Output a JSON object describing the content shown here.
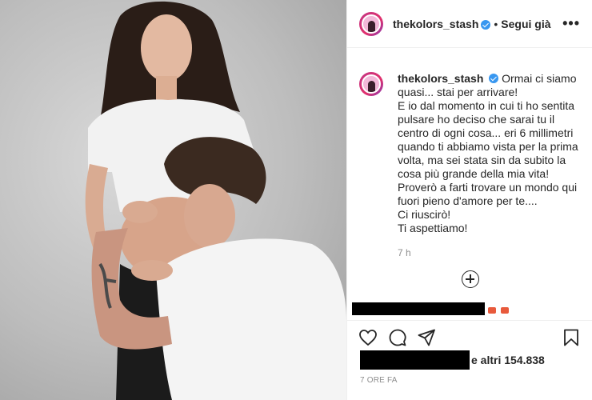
{
  "post": {
    "username": "thekolors_stash",
    "follow_label": "Segui già",
    "more_icon": "more-options-icon",
    "separator": "•"
  },
  "caption": {
    "username": "thekolors_stash",
    "lines": [
      "Ormai ci siamo",
      "quasi... stai per arrivare!",
      "E io dal momento in cui ti ho sentita",
      "pulsare ho deciso che sarai tu il",
      "centro di ogni cosa... eri 6 millimetri",
      "quando ti abbiamo vista per la prima",
      "volta, ma sei stata sin da subito la",
      "cosa più grande della mia vita!",
      "Proverò a farti trovare un mondo qui",
      "fuori pieno d'amore per te....",
      "Ci riuscirò!",
      "Ti aspettiamo!"
    ],
    "time": "7 h"
  },
  "engagement": {
    "likes_text": "e altri 154.838",
    "post_time": "7 ORE FA"
  },
  "icons": {
    "like": "heart-icon",
    "comment": "comment-icon",
    "share": "share-icon",
    "save": "bookmark-icon",
    "add_comment": "plus-circle-icon",
    "verified": "verified-badge-icon"
  },
  "colors": {
    "text": "#262626",
    "muted": "#8e8e8e",
    "verified": "#3897f0",
    "border": "#efefef"
  }
}
